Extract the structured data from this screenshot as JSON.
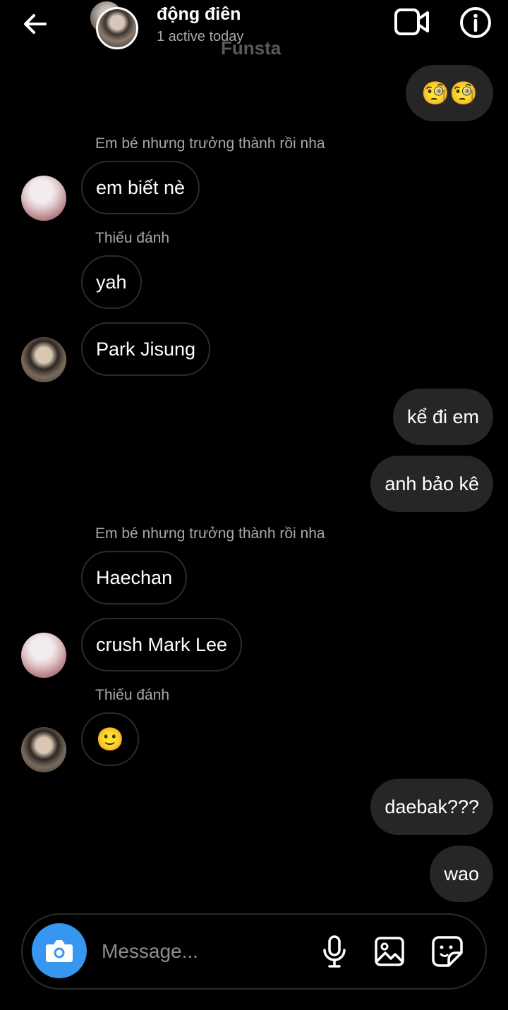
{
  "header": {
    "title": "động điên",
    "status": "1 active today",
    "watermark": "Funsta",
    "icons": {
      "back": "arrow-left-icon",
      "video": "video-camera-icon",
      "info": "info-icon"
    }
  },
  "messages": [
    {
      "side": "out",
      "text": "🧐🧐"
    },
    {
      "side": "in",
      "sender": "Em bé nhưng trưởng thành rồi nha",
      "text": "em biết nè",
      "avatar": "white-hair"
    },
    {
      "side": "in",
      "sender": "Thiếu đánh",
      "text": "yah"
    },
    {
      "side": "in",
      "text": "Park Jisung",
      "avatar": "dark-hair"
    },
    {
      "side": "out",
      "text": "kể đi em"
    },
    {
      "side": "out",
      "text": "anh bảo kê"
    },
    {
      "side": "in",
      "sender": "Em bé nhưng trưởng thành rồi nha",
      "text": "Haechan"
    },
    {
      "side": "in",
      "text": "crush Mark Lee",
      "avatar": "white-hair"
    },
    {
      "side": "in",
      "sender": "Thiếu đánh",
      "text": "🙂",
      "avatar": "dark-hair"
    },
    {
      "side": "out",
      "text": "daebak???"
    },
    {
      "side": "out",
      "text": "wao"
    }
  ],
  "composer": {
    "placeholder": "Message...",
    "icons": {
      "camera": "camera-icon",
      "mic": "microphone-icon",
      "gallery": "image-icon",
      "sticker": "sticker-icon"
    }
  },
  "colors": {
    "background": "#000000",
    "outgoing_bubble": "#262626",
    "camera_button": "#3797f0",
    "secondary_text": "#a8a8a8"
  }
}
